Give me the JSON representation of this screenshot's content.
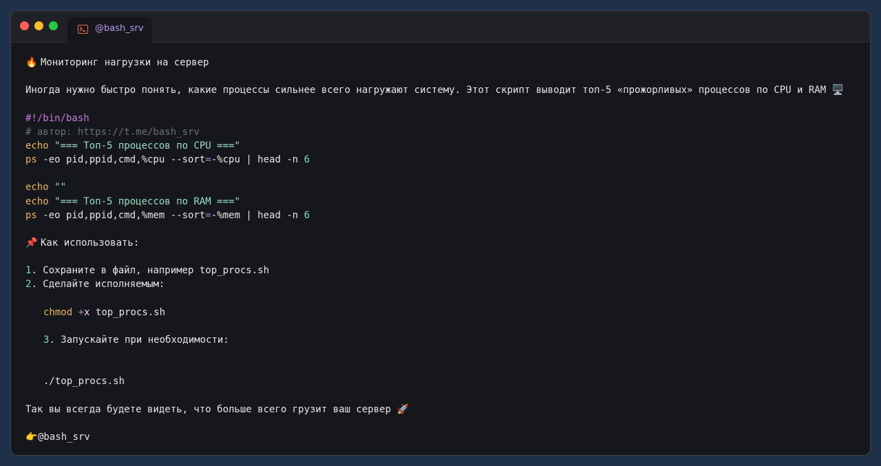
{
  "window": {
    "tab_title": "@bash_srv",
    "tab_icon": "terminal-icon",
    "colors": {
      "background": "#16171c",
      "accent": "#b79af5",
      "icon": "#f06d4d"
    }
  },
  "post": {
    "title_emoji": "🔥",
    "title": "Мониторинг нагрузки на сервер",
    "intro": "Иногда нужно быстро понять, какие процессы сильнее всего нагружают систему. Этот скрипт выводит топ-5 «прожорливых» процессов по CPU и RAM",
    "intro_emoji": "🖥️",
    "script": {
      "shebang": "#!/bin/bash",
      "comment": "# автор: https://t.me/bash_srv",
      "echo_kw": "echo",
      "echo_cpu": "\"=== Топ-5 процессов по CPU ===\"",
      "ps_kw": "ps",
      "ps_cpu_args": " -eo pid,ppid,cmd,%cpu --sort",
      "ps_cpu_sort": "-%cpu",
      "pipe_head": " | head -n ",
      "head_n": "6",
      "equals": "=",
      "echo_empty": "\"\"",
      "echo_ram": "\"=== Топ-5 процессов по RAM ===\"",
      "ps_ram_args": " -eo pid,ppid,cmd,%mem --sort",
      "ps_ram_sort": "-%mem"
    },
    "howto_emoji": "📌",
    "howto_title": "Как использовать:",
    "steps": [
      {
        "num": "1",
        "text": ". Сохраните в файл, например top_procs.sh"
      },
      {
        "num": "2",
        "text": ". Сделайте исполняемым:"
      },
      {
        "num": "3",
        "text": ". Запускайте при необходимости:"
      }
    ],
    "chmod_kw": "chmod",
    "chmod_op": "+",
    "chmod_rest": "x top_procs.sh",
    "run_cmd": "./top_procs.sh",
    "outro": "Так вы всегда будете видеть, что больше всего грузит ваш сервер",
    "outro_emoji": "🚀",
    "signature_emoji": "👉",
    "signature": "@bash_srv"
  }
}
